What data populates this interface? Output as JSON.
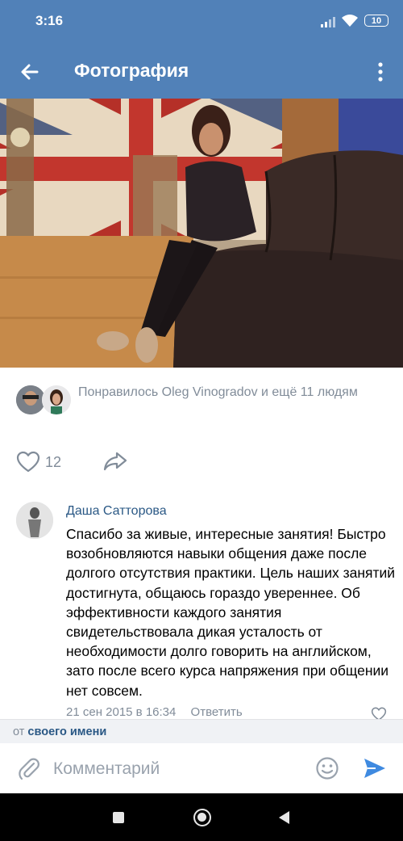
{
  "status_bar": {
    "time": "3:16",
    "battery": "10"
  },
  "app_bar": {
    "title": "Фотография"
  },
  "likes": {
    "text": "Понравилось Oleg Vinogradov и ещё 11 людям"
  },
  "actions": {
    "like_count": "12"
  },
  "comment": {
    "author": "Даша Сатторова",
    "text": "Спасибо за живые, интересные занятия! Быстро возобновляются навыки общения даже после долгого отсутствия практики. Цель наших занятий достигнута, общаюсь гораздо увереннее. Об эффективности каждого занятия свидетельствовала дикая усталость от необходимости долго говорить на английском, зато после всего курса напряжения при общении нет совсем.",
    "date": "21 сен 2015 в 16:34",
    "reply_label": "Ответить"
  },
  "from_bar": {
    "prefix": "от",
    "link": "своего имени"
  },
  "input": {
    "placeholder": "Комментарий"
  },
  "colors": {
    "header": "#5181b8",
    "link": "#2a5885",
    "secondary_text": "#818c99",
    "send_icon": "#3f8ae0"
  },
  "icons": [
    "back-arrow-icon",
    "more-vert-icon",
    "heart-icon",
    "share-icon",
    "attach-icon",
    "emoji-icon",
    "send-icon"
  ]
}
